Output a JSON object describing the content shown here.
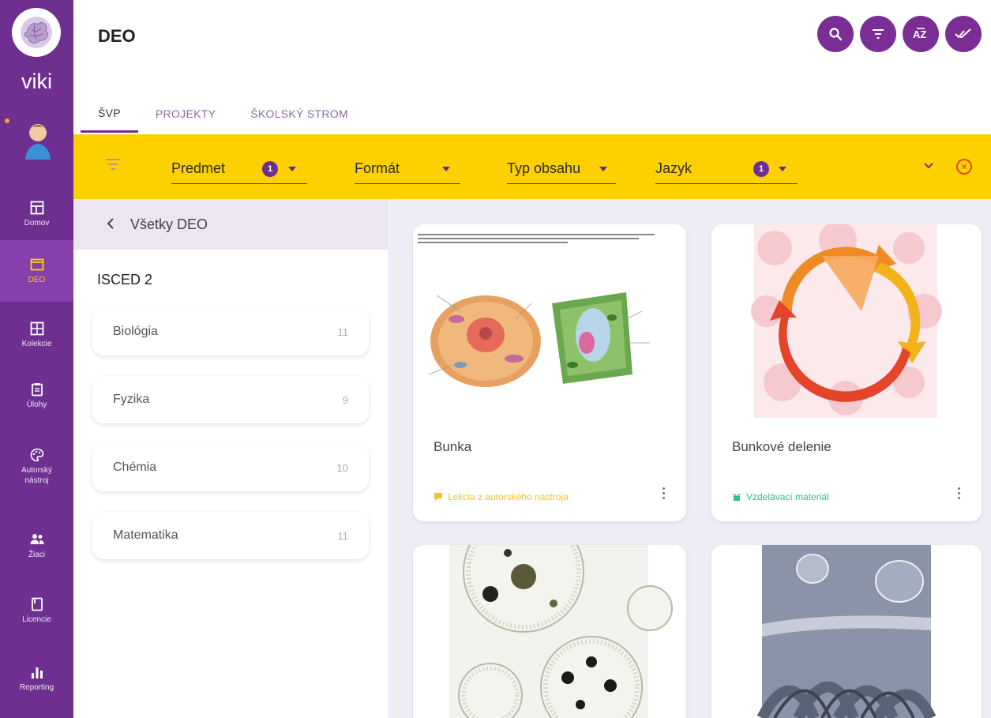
{
  "brand": {
    "name": "viki"
  },
  "sidebar": {
    "items": [
      {
        "label": "Domov",
        "icon": "dashboard-icon"
      },
      {
        "label": "DEO",
        "icon": "window-icon",
        "active": true
      },
      {
        "label": "Kolekcie",
        "icon": "grid-icon"
      },
      {
        "label": "Úlohy",
        "icon": "clipboard-icon"
      },
      {
        "label": "Autorský nástroj",
        "icon": "palette-icon"
      },
      {
        "label": "Žiaci",
        "icon": "people-icon"
      },
      {
        "label": "Licencie",
        "icon": "book-icon"
      },
      {
        "label": "Reporting",
        "icon": "bar-chart-icon"
      }
    ]
  },
  "header": {
    "title": "DEO",
    "actions": [
      "search-icon",
      "filter-list-icon",
      "sort-az-icon",
      "check-all-icon"
    ]
  },
  "tabs": [
    {
      "label": "ŠVP",
      "active": true
    },
    {
      "label": "PROJEKTY"
    },
    {
      "label": "ŠKOLSKÝ STROM"
    }
  ],
  "filters": [
    {
      "label": "Predmet",
      "badge": "1"
    },
    {
      "label": "Formát"
    },
    {
      "label": "Typ obsahu"
    },
    {
      "label": "Jazyk",
      "badge": "1"
    }
  ],
  "colors": {
    "brand": "#6e2f91",
    "filterbar": "#ffd000",
    "lesson": "#f5c518",
    "material": "#2ebf8f"
  },
  "panel": {
    "back_label": "Všetky DEO",
    "section_title": "ISCED 2",
    "subjects": [
      {
        "name": "Biológia",
        "count": "11"
      },
      {
        "name": "Fyzika",
        "count": "9"
      },
      {
        "name": "Chémia",
        "count": "10"
      },
      {
        "name": "Matematika",
        "count": "11"
      }
    ]
  },
  "cards": [
    {
      "title": "Bunka",
      "type": "Lekcia z autorského nástroja",
      "image": "cell-diagram"
    },
    {
      "title": "Bunkové delenie",
      "type": "Vzdelávací materiál",
      "image": "cell-cycle"
    },
    {
      "title": "",
      "type": "",
      "image": "microscope-cells"
    },
    {
      "title": "",
      "type": "",
      "image": "water-droplets"
    }
  ]
}
